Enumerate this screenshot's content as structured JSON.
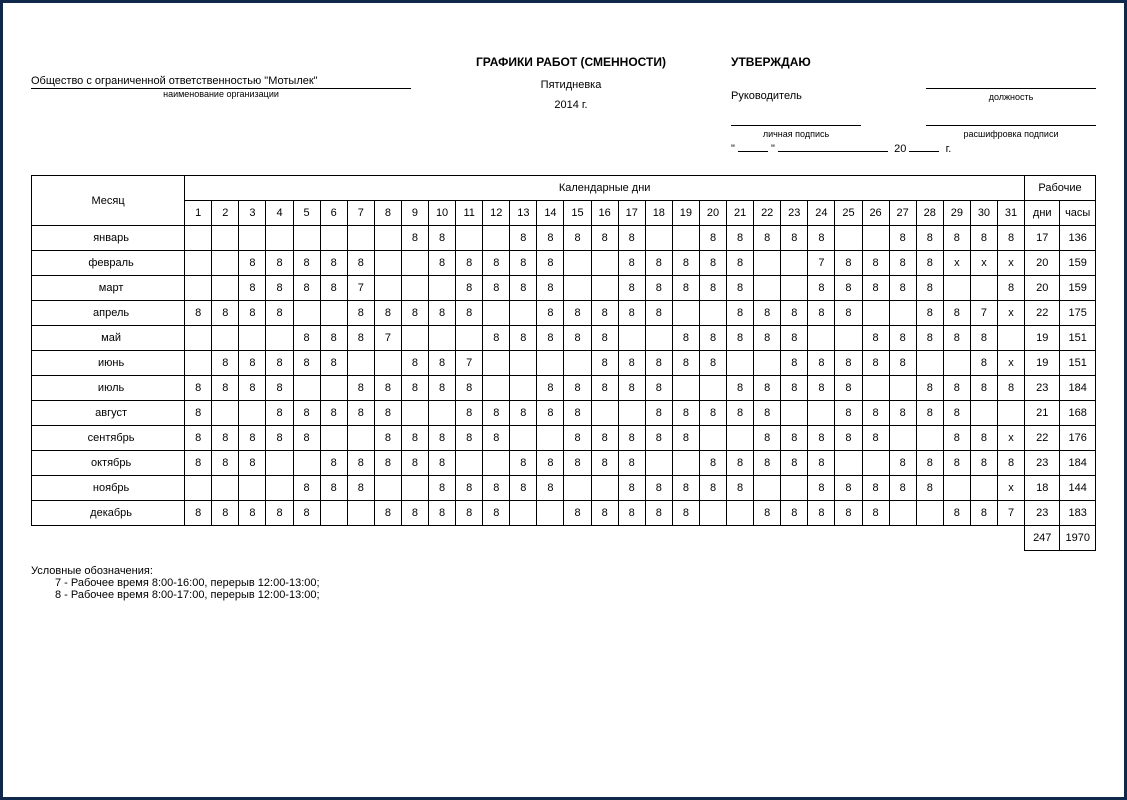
{
  "header": {
    "org_name": "Общество с ограниченной ответственностью \"Мотылек\"",
    "org_caption": "наименование организации",
    "title": "ГРАФИКИ РАБОТ (СМЕННОСТИ)",
    "subtitle": "Пятидневка",
    "year": "2014 г.",
    "approve_title": "УТВЕРЖДАЮ",
    "approve_position": "Руководитель",
    "position_caption": "должность",
    "signature_caption": "личная подпись",
    "decipher_caption": "расшифровка подписи",
    "date_prefix": "\"",
    "date_mid": "\"",
    "date_year_prefix": "20",
    "date_year_suffix": "г."
  },
  "table": {
    "month_header": "Месяц",
    "calendar_header": "Календарные дни",
    "working_header": "Рабочие",
    "days_header": "дни",
    "hours_header": "часы",
    "day_numbers": [
      "1",
      "2",
      "3",
      "4",
      "5",
      "6",
      "7",
      "8",
      "9",
      "10",
      "11",
      "12",
      "13",
      "14",
      "15",
      "16",
      "17",
      "18",
      "19",
      "20",
      "21",
      "22",
      "23",
      "24",
      "25",
      "26",
      "27",
      "28",
      "29",
      "30",
      "31"
    ],
    "rows": [
      {
        "month": "январь",
        "cells": [
          "",
          "",
          "",
          "",
          "",
          "",
          "",
          "",
          "8",
          "8",
          "",
          "",
          "8",
          "8",
          "8",
          "8",
          "8",
          "",
          "",
          "8",
          "8",
          "8",
          "8",
          "8",
          "",
          "",
          "8",
          "8",
          "8",
          "8",
          "8"
        ],
        "days": "17",
        "hours": "136"
      },
      {
        "month": "февраль",
        "cells": [
          "",
          "",
          "8",
          "8",
          "8",
          "8",
          "8",
          "",
          "",
          "8",
          "8",
          "8",
          "8",
          "8",
          "",
          "",
          "8",
          "8",
          "8",
          "8",
          "8",
          "",
          "",
          "7",
          "8",
          "8",
          "8",
          "8",
          "х",
          "х",
          "х"
        ],
        "days": "20",
        "hours": "159"
      },
      {
        "month": "март",
        "cells": [
          "",
          "",
          "8",
          "8",
          "8",
          "8",
          "7",
          "",
          "",
          "",
          "8",
          "8",
          "8",
          "8",
          "",
          "",
          "8",
          "8",
          "8",
          "8",
          "8",
          "",
          "",
          "8",
          "8",
          "8",
          "8",
          "8",
          "",
          "",
          "8"
        ],
        "days": "20",
        "hours": "159"
      },
      {
        "month": "апрель",
        "cells": [
          "8",
          "8",
          "8",
          "8",
          "",
          "",
          "8",
          "8",
          "8",
          "8",
          "8",
          "",
          "",
          "8",
          "8",
          "8",
          "8",
          "8",
          "",
          "",
          "8",
          "8",
          "8",
          "8",
          "8",
          "",
          "",
          "8",
          "8",
          "7",
          "х"
        ],
        "days": "22",
        "hours": "175"
      },
      {
        "month": "май",
        "cells": [
          "",
          "",
          "",
          "",
          "8",
          "8",
          "8",
          "7",
          "",
          "",
          "",
          "8",
          "8",
          "8",
          "8",
          "8",
          "",
          "",
          "8",
          "8",
          "8",
          "8",
          "8",
          "",
          "",
          "8",
          "8",
          "8",
          "8",
          "8",
          ""
        ],
        "days": "19",
        "hours": "151"
      },
      {
        "month": "июнь",
        "cells": [
          "",
          "8",
          "8",
          "8",
          "8",
          "8",
          "",
          "",
          "8",
          "8",
          "7",
          "",
          "",
          "",
          "",
          "8",
          "8",
          "8",
          "8",
          "8",
          "",
          "",
          "8",
          "8",
          "8",
          "8",
          "8",
          "",
          "",
          "8",
          "х"
        ],
        "days": "19",
        "hours": "151"
      },
      {
        "month": "июль",
        "cells": [
          "8",
          "8",
          "8",
          "8",
          "",
          "",
          "8",
          "8",
          "8",
          "8",
          "8",
          "",
          "",
          "8",
          "8",
          "8",
          "8",
          "8",
          "",
          "",
          "8",
          "8",
          "8",
          "8",
          "8",
          "",
          "",
          "8",
          "8",
          "8",
          "8"
        ],
        "days": "23",
        "hours": "184"
      },
      {
        "month": "август",
        "cells": [
          "8",
          "",
          "",
          "8",
          "8",
          "8",
          "8",
          "8",
          "",
          "",
          "8",
          "8",
          "8",
          "8",
          "8",
          "",
          "",
          "8",
          "8",
          "8",
          "8",
          "8",
          "",
          "",
          "8",
          "8",
          "8",
          "8",
          "8",
          "",
          ""
        ],
        "days": "21",
        "hours": "168"
      },
      {
        "month": "сентябрь",
        "cells": [
          "8",
          "8",
          "8",
          "8",
          "8",
          "",
          "",
          "8",
          "8",
          "8",
          "8",
          "8",
          "",
          "",
          "8",
          "8",
          "8",
          "8",
          "8",
          "",
          "",
          "8",
          "8",
          "8",
          "8",
          "8",
          "",
          "",
          "8",
          "8",
          "х"
        ],
        "days": "22",
        "hours": "176"
      },
      {
        "month": "октябрь",
        "cells": [
          "8",
          "8",
          "8",
          "",
          "",
          "8",
          "8",
          "8",
          "8",
          "8",
          "",
          "",
          "8",
          "8",
          "8",
          "8",
          "8",
          "",
          "",
          "8",
          "8",
          "8",
          "8",
          "8",
          "",
          "",
          "8",
          "8",
          "8",
          "8",
          "8"
        ],
        "days": "23",
        "hours": "184"
      },
      {
        "month": "ноябрь",
        "cells": [
          "",
          "",
          "",
          "",
          "8",
          "8",
          "8",
          "",
          "",
          "8",
          "8",
          "8",
          "8",
          "8",
          "",
          "",
          "8",
          "8",
          "8",
          "8",
          "8",
          "",
          "",
          "8",
          "8",
          "8",
          "8",
          "8",
          "",
          "",
          "х"
        ],
        "days": "18",
        "hours": "144"
      },
      {
        "month": "декабрь",
        "cells": [
          "8",
          "8",
          "8",
          "8",
          "8",
          "",
          "",
          "8",
          "8",
          "8",
          "8",
          "8",
          "",
          "",
          "8",
          "8",
          "8",
          "8",
          "8",
          "",
          "",
          "8",
          "8",
          "8",
          "8",
          "8",
          "",
          "",
          "8",
          "8",
          "7"
        ],
        "days": "23",
        "hours": "183"
      }
    ],
    "totals": {
      "days": "247",
      "hours": "1970"
    }
  },
  "legend": {
    "title": "Условные обозначения:",
    "item7": "7  -  Рабочее время 8:00-16:00, перерыв 12:00-13:00;",
    "item8": "8  -  Рабочее время 8:00-17:00, перерыв 12:00-13:00;"
  }
}
